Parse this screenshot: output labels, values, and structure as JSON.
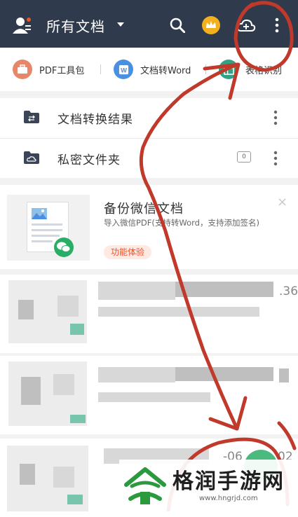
{
  "topbar": {
    "title": "所有文档"
  },
  "tools": [
    {
      "label": "PDF工具包",
      "color": "#e8866a"
    },
    {
      "label": "文档转Word",
      "color": "#4a90e2"
    },
    {
      "label": "表格识别",
      "color": "#2fa383"
    }
  ],
  "list": {
    "items": [
      {
        "label": "文档转换结果"
      },
      {
        "label": "私密文件夹",
        "count": "0"
      }
    ]
  },
  "card": {
    "title": "备份微信文档",
    "desc": "导入微信PDF(支持转Word，支持添加签名)",
    "tag": "功能体验",
    "close": "×"
  },
  "docs": {
    "partial_numbers": [
      ".36",
      "-06",
      "02"
    ]
  },
  "watermark": {
    "title": "格润手游网",
    "url": "www.hngrjd.com"
  },
  "colors": {
    "topbar": "#2f3a4c",
    "annotation": "#c0392b",
    "wechat_green": "#2aae67",
    "tag_bg": "#ffe9e3",
    "tag_text": "#e8542e"
  }
}
